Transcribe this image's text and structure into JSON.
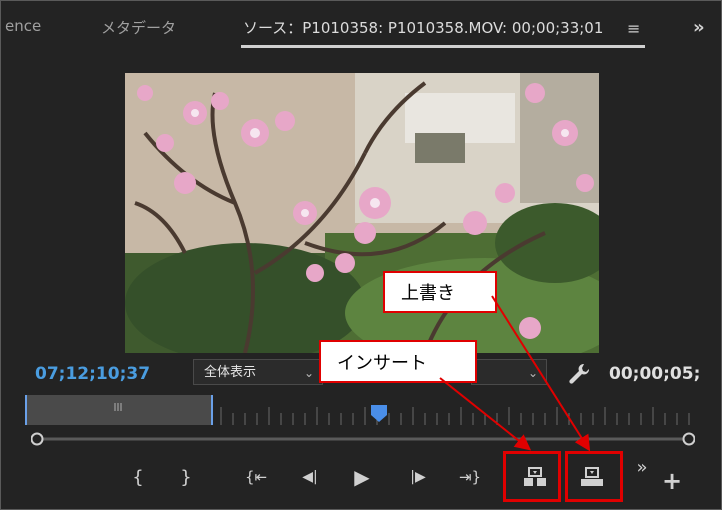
{
  "tabs": {
    "sequence_partial": "ence",
    "metadata": "メタデータ",
    "source": "ソース：P1010358: P1010358.MOV: 00;00;33;01"
  },
  "icons": {
    "tab_menu": "≡",
    "overflow": "»"
  },
  "timecode": {
    "current": "07;12;10;37",
    "duration": "00;00;05;"
  },
  "zoom_select": {
    "value": "全体表示"
  },
  "quality_select": {
    "value": ""
  },
  "controls": {
    "mark_in": "{",
    "mark_out": "}",
    "go_to_in": "{⇤",
    "step_back": "◀|",
    "play": "▶",
    "step_forward": "|▶",
    "go_to_out": "⇥}",
    "more": "»",
    "add": "+"
  },
  "annotations": {
    "overwrite": "上書き",
    "insert": "インサート"
  },
  "colors": {
    "accent": "#4a9de0",
    "highlight": "#e00000",
    "background": "#232323"
  }
}
